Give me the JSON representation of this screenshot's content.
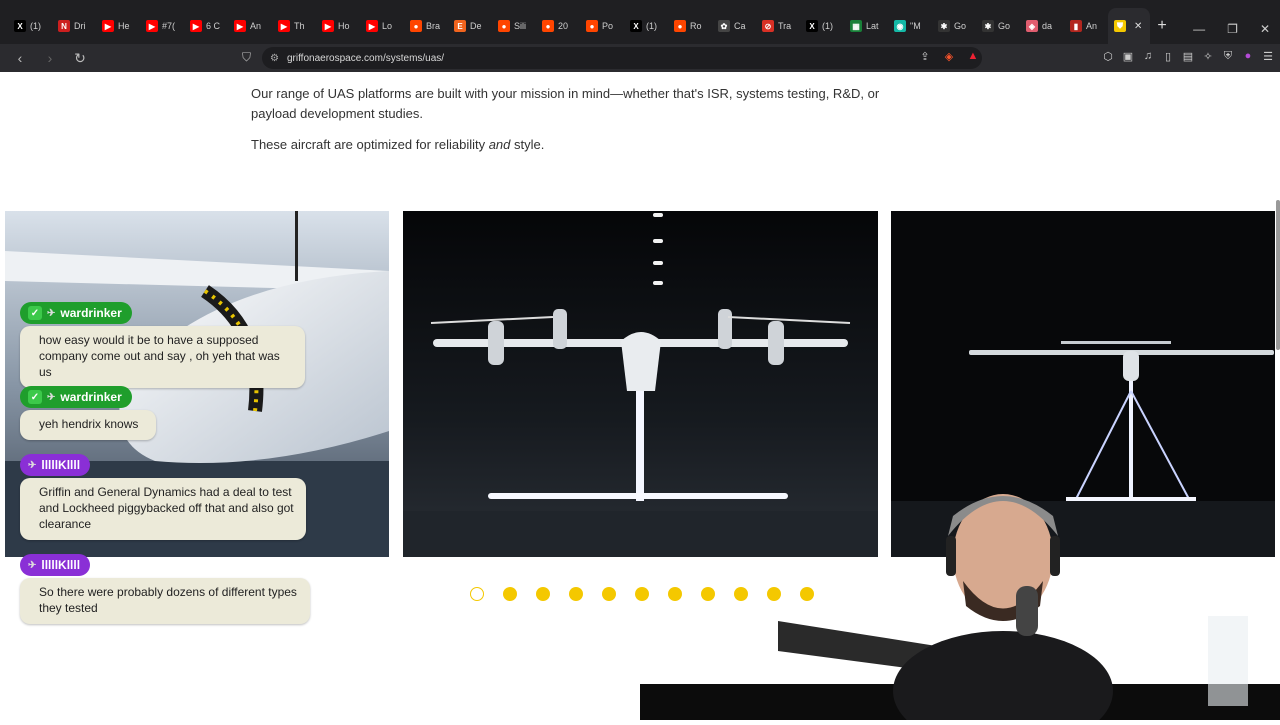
{
  "browser": {
    "tabs": [
      {
        "label": "(1)",
        "icon": "x-logo-icon",
        "color": "#000000",
        "glyph": "X"
      },
      {
        "label": "Dri",
        "icon": "news-icon",
        "color": "#cc1f1f",
        "glyph": "N"
      },
      {
        "label": "He",
        "icon": "youtube-icon",
        "color": "#ff0000",
        "glyph": "▶"
      },
      {
        "label": "#7(",
        "icon": "youtube-icon",
        "color": "#ff0000",
        "glyph": "▶"
      },
      {
        "label": "6 C",
        "icon": "youtube-icon",
        "color": "#ff0000",
        "glyph": "▶"
      },
      {
        "label": "An",
        "icon": "youtube-icon",
        "color": "#ff0000",
        "glyph": "▶"
      },
      {
        "label": "Th",
        "icon": "youtube-icon",
        "color": "#ff0000",
        "glyph": "▶"
      },
      {
        "label": "Ho",
        "icon": "youtube-icon",
        "color": "#ff0000",
        "glyph": "▶"
      },
      {
        "label": "Lo",
        "icon": "youtube-icon",
        "color": "#ff0000",
        "glyph": "▶"
      },
      {
        "label": "Bra",
        "icon": "reddit-icon",
        "color": "#ff4500",
        "glyph": "●"
      },
      {
        "label": "De",
        "icon": "etsy-icon",
        "color": "#f1641e",
        "glyph": "E"
      },
      {
        "label": "Sili",
        "icon": "reddit-icon",
        "color": "#ff4500",
        "glyph": "●"
      },
      {
        "label": "20",
        "icon": "reddit-icon",
        "color": "#ff4500",
        "glyph": "●"
      },
      {
        "label": "Po",
        "icon": "reddit-icon",
        "color": "#ff4500",
        "glyph": "●"
      },
      {
        "label": "(1)",
        "icon": "x-logo-icon",
        "color": "#000000",
        "glyph": "X"
      },
      {
        "label": "Ro",
        "icon": "reddit-icon",
        "color": "#ff4500",
        "glyph": "●"
      },
      {
        "label": "Ca",
        "icon": "openai-icon",
        "color": "#444444",
        "glyph": "✿"
      },
      {
        "label": "Tra",
        "icon": "block-icon",
        "color": "#d93025",
        "glyph": "⊘"
      },
      {
        "label": "(1)",
        "icon": "x-logo-icon",
        "color": "#000000",
        "glyph": "X"
      },
      {
        "label": "Lat",
        "icon": "sheet-icon",
        "color": "#188038",
        "glyph": "▦"
      },
      {
        "label": "\"M",
        "icon": "globe-icon",
        "color": "#14b8a6",
        "glyph": "◉"
      },
      {
        "label": "Go",
        "icon": "asterisk-icon",
        "color": "#333333",
        "glyph": "✱"
      },
      {
        "label": "Go",
        "icon": "asterisk-icon",
        "color": "#333333",
        "glyph": "✱"
      },
      {
        "label": "da",
        "icon": "shield-icon",
        "color": "#e05d6f",
        "glyph": "◈"
      },
      {
        "label": "An",
        "icon": "flag-icon",
        "color": "#b3261e",
        "glyph": "▮"
      },
      {
        "label": "",
        "icon": "griffon-logo-icon",
        "color": "#f4c800",
        "glyph": "⛊",
        "active": true
      }
    ],
    "url": "griffonaerospace.com/systems/uas/"
  },
  "page": {
    "paragraph1": "Our range of UAS platforms are built with your mission in mind—whether that's ISR, systems testing, R&D, or payload development studies.",
    "paragraph2_pre": "These aircraft are optimized for reliability ",
    "paragraph2_em": "and",
    "paragraph2_post": " style.",
    "carousel": {
      "total_slides": 11,
      "active_index": 0,
      "accent": "#f4c800"
    }
  },
  "chat": [
    {
      "user": "wardrinker",
      "badge_color": "#1f9e2c",
      "text": "how easy would it be to have a supposed company come out and say , oh yeh that was us"
    },
    {
      "user": "wardrinker",
      "badge_color": "#1f9e2c",
      "text": "yeh hendrix knows"
    },
    {
      "user": "lllllKllll",
      "badge_color": "#8a2fd6",
      "text": "Griffin and General Dynamics had a deal to test and Lockheed piggybacked off that and also got clearance"
    },
    {
      "user": "lllllKllll",
      "badge_color": "#8a2fd6",
      "text": "So there were probably dozens of different types they tested"
    }
  ]
}
